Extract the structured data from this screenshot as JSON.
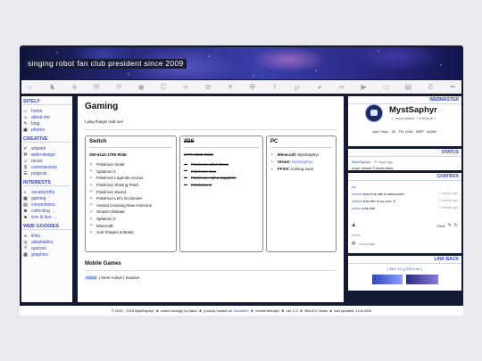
{
  "banner": {
    "title": "singing robot fan club president since 2009"
  },
  "iconbar": {
    "icons": [
      "sun-icon",
      "dog-icon",
      "butterfly-icon",
      "mastodon-icon",
      "pinterest-icon",
      "discord-icon",
      "c-icon",
      "crop-icon",
      "disc-icon",
      "x-icon",
      "cross-icon",
      "tumblr-icon",
      "p-icon",
      "github-icon",
      "ao3-icon",
      "youtube-icon",
      "twitch-icon",
      "tv-icon",
      "bluesky-icon",
      "pen-icon"
    ]
  },
  "sidebar": {
    "sections": [
      {
        "title": "SITELY",
        "items": [
          {
            "label": "home",
            "icon": "⌂"
          },
          {
            "label": "about me",
            "icon": "☺"
          },
          {
            "label": "blog",
            "icon": "✎"
          },
          {
            "label": "photos",
            "icon": "▣"
          }
        ]
      },
      {
        "title": "CREATIVE",
        "items": [
          {
            "label": "artwork",
            "icon": "✐"
          },
          {
            "label": "web+design",
            "icon": "⚒"
          },
          {
            "label": "music",
            "icon": "♫"
          },
          {
            "label": "commissions",
            "icon": "$"
          },
          {
            "label": "projects",
            "icon": "☰"
          }
        ]
      },
      {
        "title": "INTERESTS",
        "items": [
          {
            "label": "vocalsynths",
            "icon": "◐"
          },
          {
            "label": "gaming",
            "icon": "▦"
          },
          {
            "label": "conventions",
            "icon": "▤"
          },
          {
            "label": "collecting →",
            "icon": "♚"
          },
          {
            "label": "lore & lore →",
            "icon": "♣"
          }
        ]
      },
      {
        "title": "WEB GOODIES",
        "items": [
          {
            "label": "links",
            "icon": "∞"
          },
          {
            "label": "adoptables",
            "icon": "◎"
          },
          {
            "label": "quizzes",
            "icon": "?"
          },
          {
            "label": "graphics",
            "icon": "▩"
          }
        ]
      }
    ]
  },
  "main": {
    "title": "Gaming",
    "intro": "I play things! Add me!",
    "switch": {
      "title": "Switch",
      "code": "SW-6143-1780-9045",
      "games": [
        "Pokémon Violet",
        "Splatoon 3",
        "Pokémon Legends Arceus",
        "Pokémon Shining Pearl",
        "Pokémon Sword",
        "Pokémon Let's Go Eevee",
        "Animal Crossing New Horizons",
        "Smash Ultimate",
        "Splatoon 2",
        "Minecraft",
        "Just Shapes & Beats"
      ]
    },
    "ds": {
      "title": "3DS",
      "code": "1779-0338-6568",
      "games": [
        "Pokémon Ultra Moon",
        "Pokémon Sun",
        "Pokémon Alpha Sapphire",
        "Pokémon X"
      ]
    },
    "pc": {
      "title": "PC",
      "rows": [
        {
          "label": "Minecraft:",
          "value": "MystSaphyr",
          "link": false
        },
        {
          "label": "Steam:",
          "value": "MystSaphyr",
          "link": true
        },
        {
          "label": "FFXIV:",
          "value": "coming soon",
          "link": false
        }
      ]
    },
    "mobile_title": "Mobile Games",
    "legend": {
      "active": "Active",
      "rest": " | Semi-Active | Inactive"
    }
  },
  "webmaster": {
    "header": "WEBMASTER",
    "name": "MystSaphyr",
    "sub": "( \"myst saphyr\" / m'st ʃə-fɪr )",
    "info": "she / they · 33 · TN, USA · INFP · ADHD"
  },
  "status": {
    "header": "STATUS",
    "user": "MystSaphyr",
    "ago": "37 days ago",
    "message": "oops i joined 2 more zines"
  },
  "chatbox": {
    "header": "CHATBOX",
    "messages": [
      {
        "name": "joe",
        "text": "",
        "time": ""
      },
      {
        "name": "abend",
        "text": "wow this site is awesome!!",
        "time": "2 months ago"
      },
      {
        "name": "wallow",
        "text": "this site is so cool :3",
        "time": "3 months ago"
      },
      {
        "name": "siloko",
        "text": "cute site",
        "time": "3 months ago"
      }
    ],
    "clear": "Clear",
    "name_placeholder": "name",
    "homepage_placeholder": "homepage"
  },
  "linkback": {
    "header": "LINK BACK",
    "sizes": "[ 88 x 31 ]   [ 200 x 40 ]"
  },
  "footer": {
    "copyright": "© 2019 - 2024 MystSaphyr",
    "coded": "coded lovingly by hand",
    "hosted_prefix": "proudly hosted on",
    "host": "Neocities",
    "mobile": "mobile friendly!",
    "version": "ver. 2.2",
    "views": "864,521 views",
    "updated": "last updated: 10.8.2024"
  }
}
